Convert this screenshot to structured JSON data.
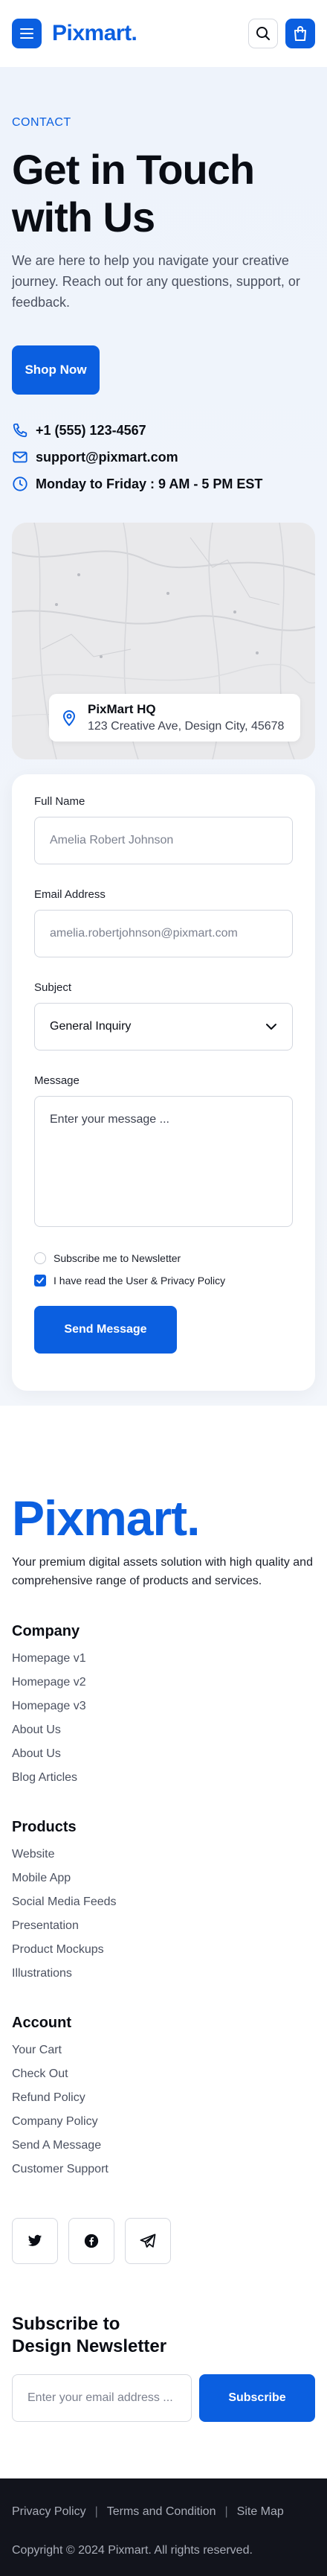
{
  "header": {
    "logo": "Pixmart.",
    "menu_icon": "hamburger-icon",
    "search_icon": "search-icon",
    "cart_icon": "shopping-bag-icon"
  },
  "hero": {
    "eyebrow": "CONTACT",
    "title_line1": "Get in Touch",
    "title_line2": "with Us",
    "description": "We are here to help you navigate your creative journey. Reach out for any questions, support, or feedback.",
    "cta_label": "Shop Now"
  },
  "contact": {
    "phone": "+1 (555) 123-4567",
    "email": "support@pixmart.com",
    "hours": "Monday to Friday : 9 AM - 5 PM EST"
  },
  "map": {
    "place_name": "PixMart HQ",
    "address": "123 Creative Ave, Design City, 45678"
  },
  "form": {
    "full_name_label": "Full Name",
    "full_name_placeholder": "Amelia Robert Johnson",
    "email_label": "Email Address",
    "email_placeholder": "amelia.robertjohnson@pixmart.com",
    "subject_label": "Subject",
    "subject_value": "General Inquiry",
    "message_label": "Message",
    "message_placeholder": "Enter your message ...",
    "newsletter_label": "Subscribe me to Newsletter",
    "newsletter_checked": false,
    "privacy_label": "I have read the User & Privacy Policy",
    "privacy_checked": true,
    "submit_label": "Send Message"
  },
  "footer": {
    "logo": "Pixmart.",
    "tagline": "Your premium digital assets solution with high quality and comprehensive range of products and services.",
    "company": {
      "heading": "Company",
      "links": [
        "Homepage v1",
        "Homepage v2",
        "Homepage v3",
        "About Us",
        "About Us",
        "Blog Articles"
      ]
    },
    "products": {
      "heading": "Products",
      "links": [
        "Website",
        "Mobile App",
        "Social Media Feeds",
        "Presentation",
        "Product Mockups",
        "Illustrations"
      ]
    },
    "account": {
      "heading": "Account",
      "links": [
        "Your Cart",
        "Check Out",
        "Refund Policy",
        "Company Policy",
        "Send A Message",
        "Customer Support"
      ]
    },
    "social_icons": [
      "twitter-icon",
      "facebook-icon",
      "telegram-icon"
    ],
    "newsletter": {
      "title_line1": "Subscribe to",
      "title_line2": "Design Newsletter",
      "placeholder": "Enter your email address ...",
      "button_label": "Subscribe"
    }
  },
  "bottom": {
    "privacy": "Privacy Policy",
    "terms": "Terms and Condition",
    "sitemap": "Site Map",
    "separator": "|",
    "copyright": "Copyright © 2024 Pixmart. All rights reserved."
  },
  "colors": {
    "primary": "#0b5fe0",
    "dark": "#12141c",
    "hero_bg": "#eef3fb"
  }
}
